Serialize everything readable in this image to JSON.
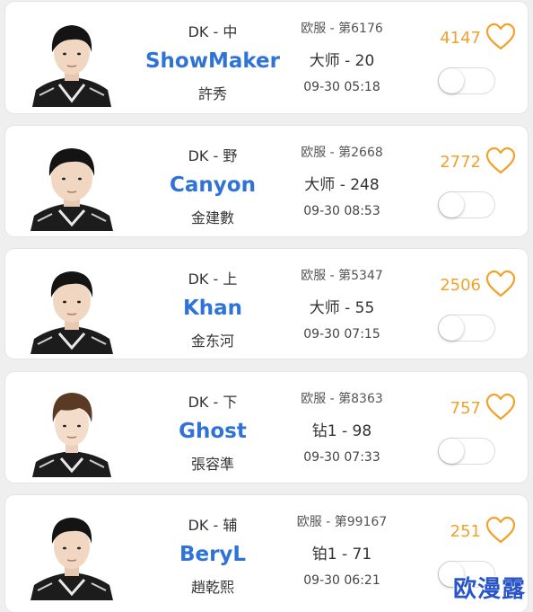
{
  "colors": {
    "name_blue": "#2f73d6",
    "likes_orange": "#f0a22a",
    "card_bg": "#ffffff",
    "page_bg": "#efefef"
  },
  "players": [
    {
      "team_role": "DK - 中",
      "name": "ShowMaker",
      "real_name": "許秀",
      "server": "欧服 - 第6176",
      "rank": "大师 - 20",
      "time": "09-30 05:18",
      "likes": "4147",
      "icon": "heart-outline-icon",
      "toggle_on": false
    },
    {
      "team_role": "DK - 野",
      "name": "Canyon",
      "real_name": "金建數",
      "server": "欧服 - 第2668",
      "rank": "大师 - 248",
      "time": "09-30 08:53",
      "likes": "2772",
      "icon": "heart-outline-icon",
      "toggle_on": false
    },
    {
      "team_role": "DK - 上",
      "name": "Khan",
      "real_name": "金东河",
      "server": "欧服 - 第5347",
      "rank": "大师 - 55",
      "time": "09-30 07:15",
      "likes": "2506",
      "icon": "heart-outline-icon",
      "toggle_on": false
    },
    {
      "team_role": "DK - 下",
      "name": "Ghost",
      "real_name": "張容準",
      "server": "欧服 - 第8363",
      "rank": "钻1 - 98",
      "time": "09-30 07:33",
      "likes": "757",
      "icon": "heart-outline-icon",
      "toggle_on": false
    },
    {
      "team_role": "DK - 辅",
      "name": "BeryL",
      "real_name": "趙乾熙",
      "server": "欧服 - 第99167",
      "rank": "铂1 - 71",
      "time": "09-30 06:21",
      "likes": "251",
      "icon": "heart-outline-icon",
      "toggle_on": false
    }
  ],
  "watermark": "欧漫露"
}
